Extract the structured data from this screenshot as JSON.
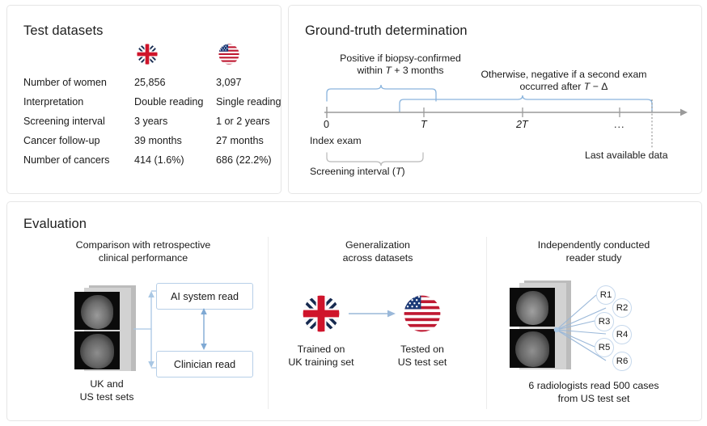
{
  "figure": {
    "accent_blue": "#8ab4dd",
    "axis_gray": "#9a9a9a",
    "panel_border": "#e6e6e6"
  },
  "panels": {
    "datasets": {
      "title": "Test datasets",
      "columns": [
        {
          "key": "uk",
          "flag": "uk-flag-icon",
          "name": "United Kingdom"
        },
        {
          "key": "us",
          "flag": "us-flag-icon",
          "name": "United States"
        }
      ],
      "rows": [
        {
          "label": "Number of women",
          "uk": "25,856",
          "us": "3,097"
        },
        {
          "label": "Interpretation",
          "uk": "Double reading",
          "us": "Single reading"
        },
        {
          "label": "Screening interval",
          "uk": "3 years",
          "us": "1 or 2 years"
        },
        {
          "label": "Cancer follow-up",
          "uk": "39 months",
          "us": "27 months"
        },
        {
          "label": "Number of cancers",
          "uk": "414 (1.6%)",
          "us": "686 (22.2%)"
        }
      ]
    },
    "ground_truth": {
      "title": "Ground-truth determination",
      "positive_note_line1": "Positive if biopsy-confirmed",
      "positive_note_line2_pre": "within ",
      "positive_note_line2_var": "T",
      "positive_note_line2_post": " + 3 months",
      "negative_note_line1": "Otherwise, negative if a second exam",
      "negative_note_line2_pre": "occurred after ",
      "negative_note_line2_var": "T",
      "negative_note_line2_post": " − Δ",
      "ticks": [
        {
          "label": "0",
          "italic": false
        },
        {
          "label": "T",
          "italic": true
        },
        {
          "label": "2T",
          "italic": true
        },
        {
          "label": "...",
          "italic": false
        }
      ],
      "index_exam_label": "Index exam",
      "last_data_label": "Last available data",
      "interval_label_pre": "Screening interval (",
      "interval_label_var": "T",
      "interval_label_post": ")"
    },
    "evaluation": {
      "title": "Evaluation",
      "sections": [
        {
          "heading_line1": "Comparison with retrospective",
          "heading_line2": "clinical performance",
          "read_boxes": [
            "AI system read",
            "Clinician read"
          ],
          "caption_line1": "UK and",
          "caption_line2": "US test sets"
        },
        {
          "heading_line1": "Generalization",
          "heading_line2": "across datasets",
          "left_flag": "uk-flag-icon",
          "right_flag": "us-flag-icon",
          "left_caption_line1": "Trained on",
          "left_caption_line2": "UK training set",
          "right_caption_line1": "Tested on",
          "right_caption_line2": "US test set"
        },
        {
          "heading_line1": "Independently conducted",
          "heading_line2": "reader study",
          "readers": [
            "R1",
            "R2",
            "R3",
            "R4",
            "R5",
            "R6"
          ],
          "caption_line1": "6 radiologists read 500 cases",
          "caption_line2": "from US test set"
        }
      ]
    }
  }
}
